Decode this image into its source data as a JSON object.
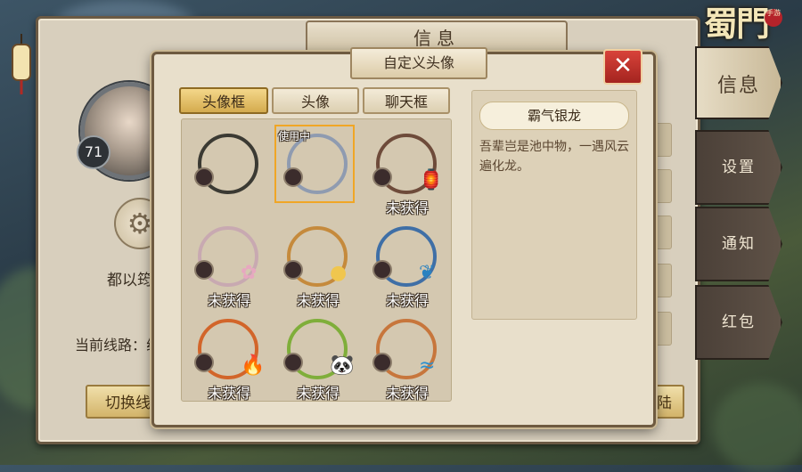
{
  "info_panel": {
    "title": "信息",
    "player_level": "71",
    "player_name": "都以筠",
    "line_label": "当前线路：线",
    "switch_line_button": "切换线路",
    "login_button_fragment": "陆"
  },
  "logo": {
    "text": "蜀門",
    "seal_text": "手游"
  },
  "side_tabs": [
    {
      "label": "信息",
      "active": true
    },
    {
      "label": "设置",
      "active": false
    },
    {
      "label": "通知",
      "active": false
    },
    {
      "label": "红包",
      "active": false
    }
  ],
  "modal": {
    "title": "自定义头像",
    "close_icon": "close-icon",
    "tabs": [
      {
        "label": "头像框",
        "active": true
      },
      {
        "label": "头像",
        "active": false
      },
      {
        "label": "聊天框",
        "active": false
      }
    ],
    "in_use_label": "使用中",
    "frames": [
      {
        "name": "basic-frame",
        "ring_color": "#3b3a33",
        "deco": "",
        "locked": false,
        "status": ""
      },
      {
        "name": "silver-dragon-frame",
        "ring_color": "#8f9bb0",
        "deco": "",
        "locked": false,
        "status": "",
        "selected": true
      },
      {
        "name": "lantern-frame",
        "ring_color": "#6e4b3a",
        "deco": "lantern-icon",
        "locked": true,
        "status": "未获得"
      },
      {
        "name": "plum-blossom-frame",
        "ring_color": "#c8a9b1",
        "deco": "blossom-icon",
        "locked": true,
        "status": "未获得"
      },
      {
        "name": "moon-flower-frame",
        "ring_color": "#c58a3c",
        "deco": "moon-icon",
        "locked": true,
        "status": "未获得"
      },
      {
        "name": "peacock-frame",
        "ring_color": "#3f6fa6",
        "deco": "feather-icon",
        "locked": true,
        "status": "未获得"
      },
      {
        "name": "flame-frame",
        "ring_color": "#d2652a",
        "deco": "flame-icon",
        "locked": true,
        "status": "未获得"
      },
      {
        "name": "panda-bamboo-frame",
        "ring_color": "#7fae3a",
        "deco": "panda-icon",
        "locked": true,
        "status": "未获得"
      },
      {
        "name": "water-fire-frame",
        "ring_color": "#c7763c",
        "deco": "wave-icon",
        "locked": true,
        "status": "未获得"
      }
    ],
    "selected_frame": {
      "name": "霸气银龙",
      "description": "吾辈岂是池中物，一遇风云遍化龙。"
    }
  },
  "colors": {
    "accent_gold": "#d4ab4e",
    "close_red": "#c0322b",
    "panel_bg": "#e8dfcb"
  }
}
